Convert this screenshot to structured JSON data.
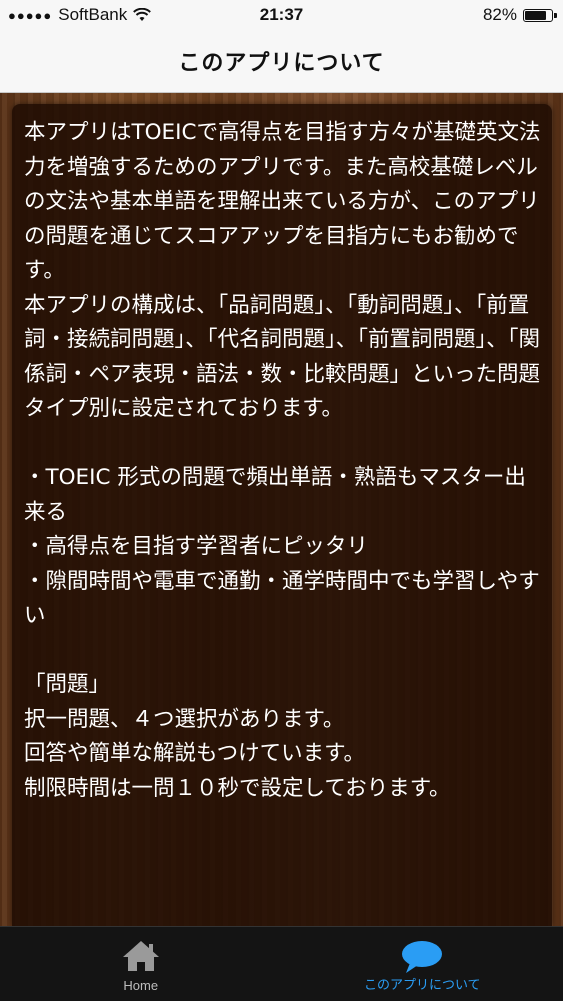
{
  "status_bar": {
    "carrier": "SoftBank",
    "signal_dots": "●●●●●",
    "time": "21:37",
    "battery": "82%",
    "battery_level": 0.82
  },
  "navbar": {
    "title": "このアプリについて"
  },
  "content": {
    "body": "本アプリはTOEICで高得点を目指す方々が基礎英文法力を増強するためのアプリです。また高校基礎レベルの文法や基本単語を理解出来ている方が、このアプリの問題を通じてスコアアップを目指方にもお勧めです。\n本アプリの構成は、「品詞問題」、「動詞問題」、「前置詞・接続詞問題」、「代名詞問題」、「前置詞問題」、「関係詞・ペア表現・語法・数・比較問題」といった問題タイプ別に設定されております。\n\n・TOEIC 形式の問題で頻出単語・熟語もマスター出来る\n・高得点を目指す学習者にピッタリ\n・隙間時間や電車で通勤・通学時間中でも学習しやすい\n\n「問題」\n択一問題、４つ選択があります。\n回答や簡単な解説もつけています。\n制限時間は一問１０秒で設定しております。"
  },
  "tabbar": {
    "tabs": [
      {
        "label": "Home",
        "icon": "home-icon",
        "selected": false
      },
      {
        "label": "このアプリについて",
        "icon": "speech-bubble-icon",
        "selected": true
      }
    ],
    "active_color": "#2a9df4",
    "inactive_color": "#bdbdbd"
  }
}
